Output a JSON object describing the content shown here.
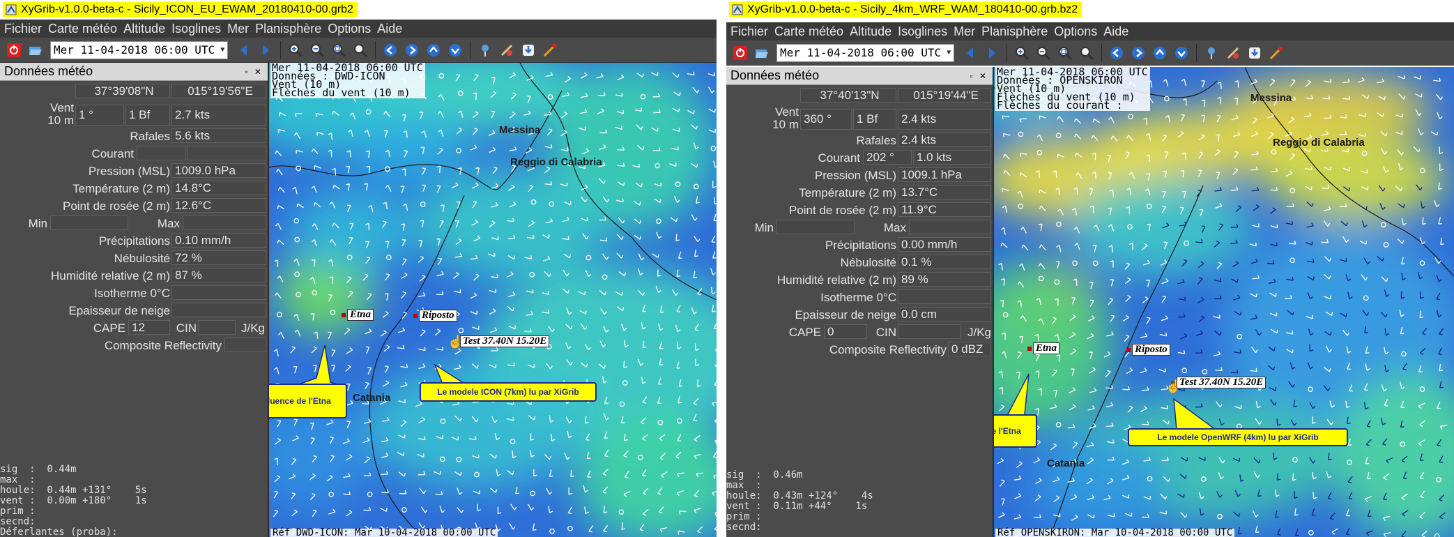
{
  "windows": [
    {
      "title": "XyGrib-v1.0.0-beta-c - Sicily_ICON_EU_EWAM_20180410-00.grb2",
      "menu": [
        "Fichier",
        "Carte météo",
        "Altitude",
        "Isoglines",
        "Mer",
        "Planisphère",
        "Options",
        "Aide"
      ],
      "date_value": "Mer 11-04-2018 06:00 UTC",
      "panel": {
        "title": "Données météo",
        "controls": "▫ ✕",
        "lat": "37°39'08\"N",
        "lon": "015°19'56\"E",
        "wind_label": "Vent\n10 m",
        "wind_label_a": "Vent",
        "wind_label_b": "10 m",
        "wind_dir": "1 °",
        "wind_bf": "1 Bf",
        "wind_speed": "2.7  kts",
        "gusts_label": "Rafales",
        "gusts_value": "5.6  kts",
        "current_label": "Courant",
        "current_dir": "",
        "current_speed": "",
        "pressure_label": "Pression (MSL)",
        "pressure_value": "1009.0 hPa",
        "temp_label": "Température (2 m)",
        "temp_value": "14.8°C",
        "dew_label": "Point de rosée (2 m)",
        "dew_value": "12.6°C",
        "min_label": "Min",
        "max_label": "Max",
        "precip_label": "Précipitations",
        "precip_value": "0.10 mm/h",
        "cloud_label": "Nébulosité",
        "cloud_value": "72 %",
        "humid_label": "Humidité relative (2 m)",
        "humid_value": "87 %",
        "iso_label": "Isotherme 0°C",
        "iso_value": "",
        "snow_label": "Epaisseur de neige",
        "snow_value": "",
        "cape_label": "CAPE",
        "cape_value": "12",
        "cin_label": "CIN",
        "cin_value": "",
        "jkg_label": "J/Kg",
        "refl_label": "Composite Reflectivity",
        "refl_value": "",
        "wave_text": "sig  :  0.44m\nmax  :\nhoule:  0.44m +131°    5s\nvent :  0.00m +180°    1s\nprim :\nsecnd:\nDéferlantes (proba):"
      },
      "map": {
        "info": "Mer 11-04-2018 06:00 UTC\nDonnées : DWD-ICON\nVent (10 m)\nFlèches du vent (10 m)",
        "ref": "Réf DWD-ICON: Mar 10-04-2018 00:00 UTC",
        "cities": {
          "messina": "Messina",
          "reggio": "Reggio di Calabria",
          "catania": "Catania"
        },
        "pois": {
          "etna": "Etna",
          "riposto": "Riposto",
          "test": "Test 37.40N 15.20E"
        },
        "callout_etna": "Influence de l'Etna",
        "callout_model": "Le modele ICON (7km) lu par XiGrib"
      }
    },
    {
      "title": "XyGrib-v1.0.0-beta-c - Sicily_4km_WRF_WAM_180410-00.grb.bz2",
      "menu": [
        "Fichier",
        "Carte météo",
        "Altitude",
        "Isoglines",
        "Mer",
        "Planisphère",
        "Options",
        "Aide"
      ],
      "date_value": "Mer 11-04-2018 06:00 UTC",
      "panel": {
        "title": "Données météo",
        "controls": "▫ ✕",
        "lat": "37°40'13\"N",
        "lon": "015°19'44\"E",
        "wind_label_a": "Vent",
        "wind_label_b": "10 m",
        "wind_dir": "360 °",
        "wind_bf": "1 Bf",
        "wind_speed": "2.4  kts",
        "gusts_label": "Rafales",
        "gusts_value": "2.4  kts",
        "current_label": "Courant",
        "current_dir": "202 °",
        "current_speed": "1.0  kts",
        "pressure_label": "Pression (MSL)",
        "pressure_value": "1009.1 hPa",
        "temp_label": "Température (2 m)",
        "temp_value": "13.7°C",
        "dew_label": "Point de rosée (2 m)",
        "dew_value": "11.9°C",
        "min_label": "Min",
        "max_label": "Max",
        "precip_label": "Précipitations",
        "precip_value": "0.00 mm/h",
        "cloud_label": "Nébulosité",
        "cloud_value": "0.1 %",
        "humid_label": "Humidité relative (2 m)",
        "humid_value": "89 %",
        "iso_label": "Isotherme 0°C",
        "iso_value": "",
        "snow_label": "Epaisseur de neige",
        "snow_value": "0.0 cm",
        "cape_label": "CAPE",
        "cape_value": "0",
        "cin_label": "CIN",
        "cin_value": "",
        "jkg_label": "J/Kg",
        "refl_label": "Composite Reflectivity",
        "refl_value": "0 dBZ",
        "wave_text": "sig  :  0.46m\nmax  :\nhoule:  0.43m +124°    4s\nvent :  0.11m +44°    1s\nprim :\nsecnd:"
      },
      "map": {
        "info": "Mer 11-04-2018 06:00 UTC\nDonnées : OPENSKIRON\nVent (10 m)\nFlèches du vent (10 m)\nFlèches du courant :",
        "ref": "Réf OPENSKIRON: Mar 10-04-2018 00:00 UTC",
        "cities": {
          "messina": "Messina",
          "reggio": "Reggio di Calabria",
          "catania": "Catania"
        },
        "pois": {
          "etna": "Etna",
          "riposto": "Riposto",
          "test": "Test 37.40N 15.20E"
        },
        "callout_etna": "Influence de l'Etna",
        "callout_model": "Le modele OpenWRF (4km) lu par XiGrib"
      }
    }
  ],
  "colors": {
    "highlight": "#ffff00",
    "menubar": "#3a3a3a",
    "toolbar": "#4a4a4a",
    "panel": "#4b4b4b",
    "callout_border": "#1a2a8a",
    "poi_marker": "#c00000"
  }
}
